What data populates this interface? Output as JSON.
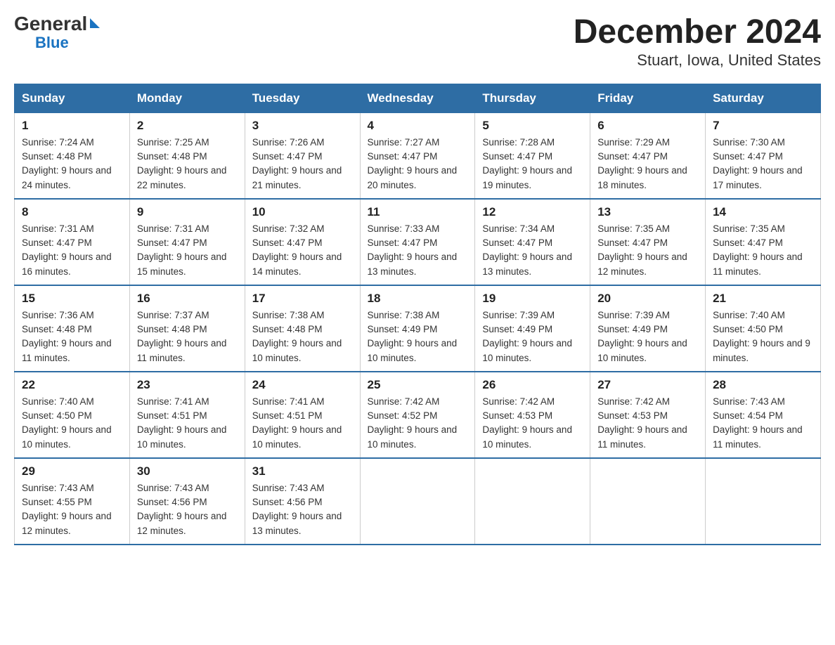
{
  "logo": {
    "general": "General",
    "blue": "Blue"
  },
  "title": "December 2024",
  "subtitle": "Stuart, Iowa, United States",
  "weekdays": [
    "Sunday",
    "Monday",
    "Tuesday",
    "Wednesday",
    "Thursday",
    "Friday",
    "Saturday"
  ],
  "weeks": [
    [
      {
        "day": 1,
        "sunrise": "7:24 AM",
        "sunset": "4:48 PM",
        "daylight": "9 hours and 24 minutes."
      },
      {
        "day": 2,
        "sunrise": "7:25 AM",
        "sunset": "4:48 PM",
        "daylight": "9 hours and 22 minutes."
      },
      {
        "day": 3,
        "sunrise": "7:26 AM",
        "sunset": "4:47 PM",
        "daylight": "9 hours and 21 minutes."
      },
      {
        "day": 4,
        "sunrise": "7:27 AM",
        "sunset": "4:47 PM",
        "daylight": "9 hours and 20 minutes."
      },
      {
        "day": 5,
        "sunrise": "7:28 AM",
        "sunset": "4:47 PM",
        "daylight": "9 hours and 19 minutes."
      },
      {
        "day": 6,
        "sunrise": "7:29 AM",
        "sunset": "4:47 PM",
        "daylight": "9 hours and 18 minutes."
      },
      {
        "day": 7,
        "sunrise": "7:30 AM",
        "sunset": "4:47 PM",
        "daylight": "9 hours and 17 minutes."
      }
    ],
    [
      {
        "day": 8,
        "sunrise": "7:31 AM",
        "sunset": "4:47 PM",
        "daylight": "9 hours and 16 minutes."
      },
      {
        "day": 9,
        "sunrise": "7:31 AM",
        "sunset": "4:47 PM",
        "daylight": "9 hours and 15 minutes."
      },
      {
        "day": 10,
        "sunrise": "7:32 AM",
        "sunset": "4:47 PM",
        "daylight": "9 hours and 14 minutes."
      },
      {
        "day": 11,
        "sunrise": "7:33 AM",
        "sunset": "4:47 PM",
        "daylight": "9 hours and 13 minutes."
      },
      {
        "day": 12,
        "sunrise": "7:34 AM",
        "sunset": "4:47 PM",
        "daylight": "9 hours and 13 minutes."
      },
      {
        "day": 13,
        "sunrise": "7:35 AM",
        "sunset": "4:47 PM",
        "daylight": "9 hours and 12 minutes."
      },
      {
        "day": 14,
        "sunrise": "7:35 AM",
        "sunset": "4:47 PM",
        "daylight": "9 hours and 11 minutes."
      }
    ],
    [
      {
        "day": 15,
        "sunrise": "7:36 AM",
        "sunset": "4:48 PM",
        "daylight": "9 hours and 11 minutes."
      },
      {
        "day": 16,
        "sunrise": "7:37 AM",
        "sunset": "4:48 PM",
        "daylight": "9 hours and 11 minutes."
      },
      {
        "day": 17,
        "sunrise": "7:38 AM",
        "sunset": "4:48 PM",
        "daylight": "9 hours and 10 minutes."
      },
      {
        "day": 18,
        "sunrise": "7:38 AM",
        "sunset": "4:49 PM",
        "daylight": "9 hours and 10 minutes."
      },
      {
        "day": 19,
        "sunrise": "7:39 AM",
        "sunset": "4:49 PM",
        "daylight": "9 hours and 10 minutes."
      },
      {
        "day": 20,
        "sunrise": "7:39 AM",
        "sunset": "4:49 PM",
        "daylight": "9 hours and 10 minutes."
      },
      {
        "day": 21,
        "sunrise": "7:40 AM",
        "sunset": "4:50 PM",
        "daylight": "9 hours and 9 minutes."
      }
    ],
    [
      {
        "day": 22,
        "sunrise": "7:40 AM",
        "sunset": "4:50 PM",
        "daylight": "9 hours and 10 minutes."
      },
      {
        "day": 23,
        "sunrise": "7:41 AM",
        "sunset": "4:51 PM",
        "daylight": "9 hours and 10 minutes."
      },
      {
        "day": 24,
        "sunrise": "7:41 AM",
        "sunset": "4:51 PM",
        "daylight": "9 hours and 10 minutes."
      },
      {
        "day": 25,
        "sunrise": "7:42 AM",
        "sunset": "4:52 PM",
        "daylight": "9 hours and 10 minutes."
      },
      {
        "day": 26,
        "sunrise": "7:42 AM",
        "sunset": "4:53 PM",
        "daylight": "9 hours and 10 minutes."
      },
      {
        "day": 27,
        "sunrise": "7:42 AM",
        "sunset": "4:53 PM",
        "daylight": "9 hours and 11 minutes."
      },
      {
        "day": 28,
        "sunrise": "7:43 AM",
        "sunset": "4:54 PM",
        "daylight": "9 hours and 11 minutes."
      }
    ],
    [
      {
        "day": 29,
        "sunrise": "7:43 AM",
        "sunset": "4:55 PM",
        "daylight": "9 hours and 12 minutes."
      },
      {
        "day": 30,
        "sunrise": "7:43 AM",
        "sunset": "4:56 PM",
        "daylight": "9 hours and 12 minutes."
      },
      {
        "day": 31,
        "sunrise": "7:43 AM",
        "sunset": "4:56 PM",
        "daylight": "9 hours and 13 minutes."
      },
      null,
      null,
      null,
      null
    ]
  ]
}
